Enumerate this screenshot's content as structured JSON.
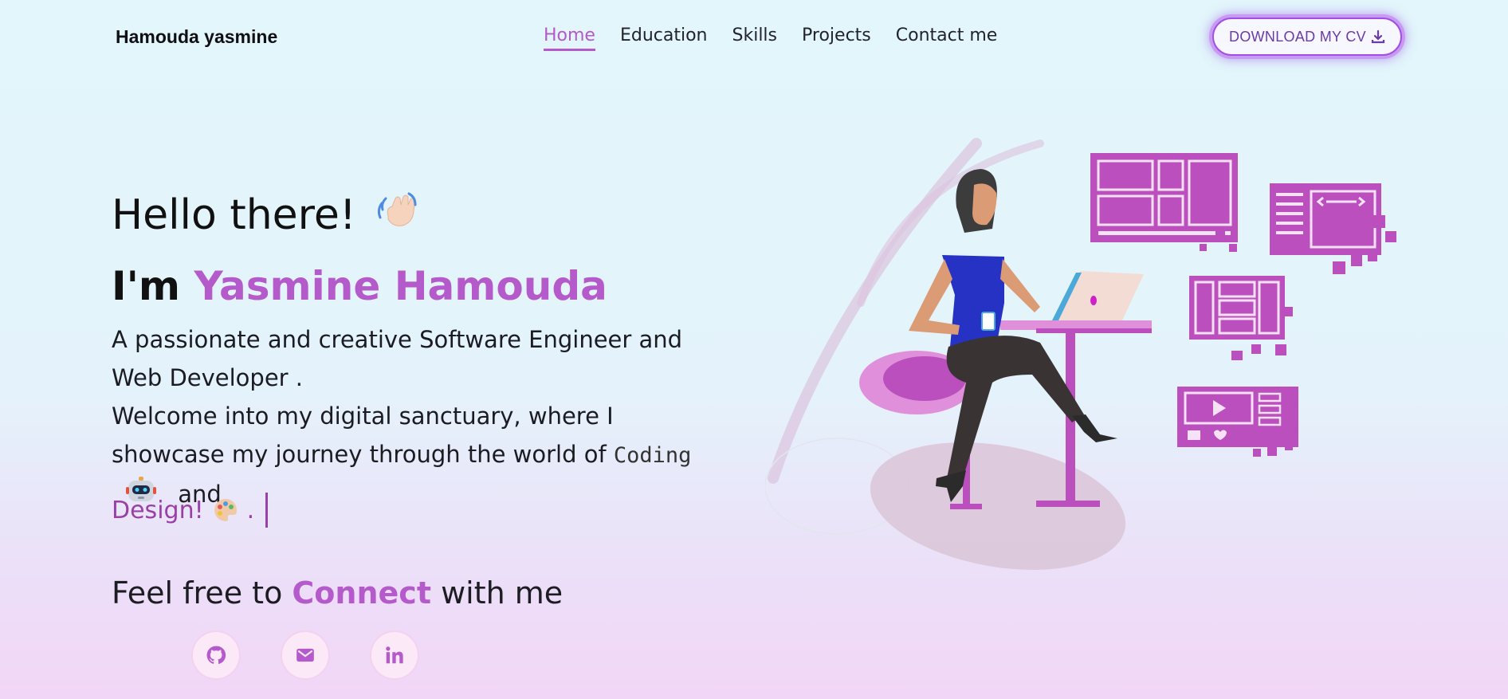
{
  "header": {
    "brand": "Hamouda yasmine",
    "nav": [
      {
        "label": "Home",
        "active": true
      },
      {
        "label": "Education",
        "active": false
      },
      {
        "label": "Skills",
        "active": false
      },
      {
        "label": "Projects",
        "active": false
      },
      {
        "label": "Contact me",
        "active": false
      }
    ],
    "cv_button": "DOWNLOAD MY CV",
    "cv_icon": "download-icon"
  },
  "hero": {
    "greeting": "Hello there!",
    "greeting_icon": "waving-hand-icon",
    "name_prefix": "I'm",
    "name_highlight": "Yasmine Hamouda",
    "desc_line1": "A passionate and creative Software Engineer and Web Developer .",
    "desc_line2": "Welcome into my digital sanctuary, where I showcase my journey through the world of",
    "coding_word": "Coding",
    "coding_icon": "robot-icon",
    "and_word": "and",
    "typed_text": "Design!",
    "typed_icon": "palette-icon",
    "typed_suffix": "."
  },
  "connect": {
    "title_prefix": "Feel free to",
    "title_highlight": "Connect",
    "title_suffix": "with me",
    "links": [
      {
        "icon": "github-icon"
      },
      {
        "icon": "mail-icon"
      },
      {
        "icon": "linkedin-icon"
      }
    ]
  },
  "colors": {
    "accent": "#b55acb",
    "illustration": "#bb4fbd",
    "button_border": "#a24de6"
  }
}
